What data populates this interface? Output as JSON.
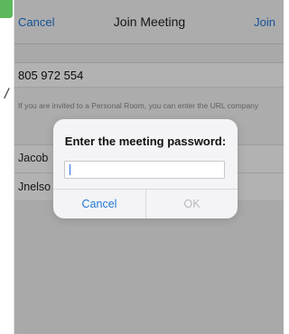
{
  "window": {
    "title": "Join Meeting"
  },
  "nav": {
    "left_label": "Cancel",
    "title": "Join Meeting",
    "right_label": "Join"
  },
  "form": {
    "meeting_id": "805 972 554",
    "hint": "If you are invited to a Personal Room, you can enter the URL company",
    "name": "Jacob",
    "email_partial": "Jnelso"
  },
  "dialog": {
    "title": "Enter the meeting password:",
    "password_value": "",
    "cancel_label": "Cancel",
    "ok_label": "OK"
  },
  "colors": {
    "accent": "#1f77d6",
    "disabled": "#b8b8bc",
    "side_tab": "#5cb85c"
  },
  "left_mark": "/"
}
